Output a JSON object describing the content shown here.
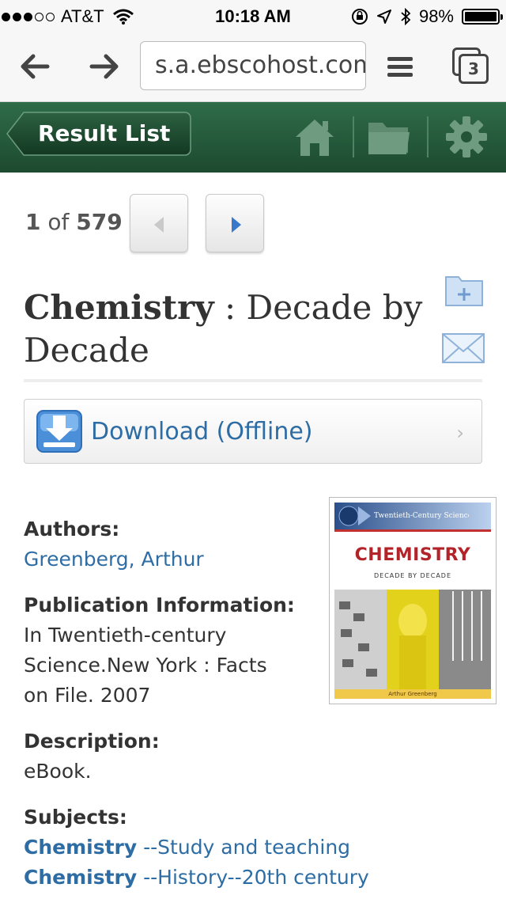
{
  "status_bar": {
    "carrier": "AT&T",
    "time": "10:18 AM",
    "battery": "98%",
    "signal_bars_filled": 3,
    "signal_bars_total": 5
  },
  "browser": {
    "url": "s.a.ebscohost.com",
    "tab_count": "3"
  },
  "header": {
    "result_list_label": "Result List",
    "icons": [
      "home-icon",
      "folder-icon",
      "gear-icon"
    ]
  },
  "navigation": {
    "current": "1",
    "separator": "of",
    "total": "579"
  },
  "record": {
    "title_main": "Chemistry",
    "title_rest": " : Decade by Decade",
    "download_label": "Download (Offline)",
    "authors_label": "Authors:",
    "authors_value": "Greenberg, Arthur",
    "pubinfo_label": "Publication Information:",
    "pubinfo_value": "In Twentieth-century Science.New York : Facts on File. 2007",
    "description_label": "Description:",
    "description_value": "eBook.",
    "subjects_label": "Subjects:",
    "subjects": [
      {
        "term": "Chemistry",
        "rest": " --Study and teaching"
      },
      {
        "term": "Chemistry",
        "rest": " --History--20th century"
      }
    ]
  },
  "cover": {
    "series": "Twentieth-Century Science",
    "title": "CHEMISTRY",
    "subtitle": "DECADE BY DECADE",
    "author": "Arthur Greenberg"
  },
  "colors": {
    "header_green": "#1d4a30",
    "link_blue": "#2e6da4"
  }
}
